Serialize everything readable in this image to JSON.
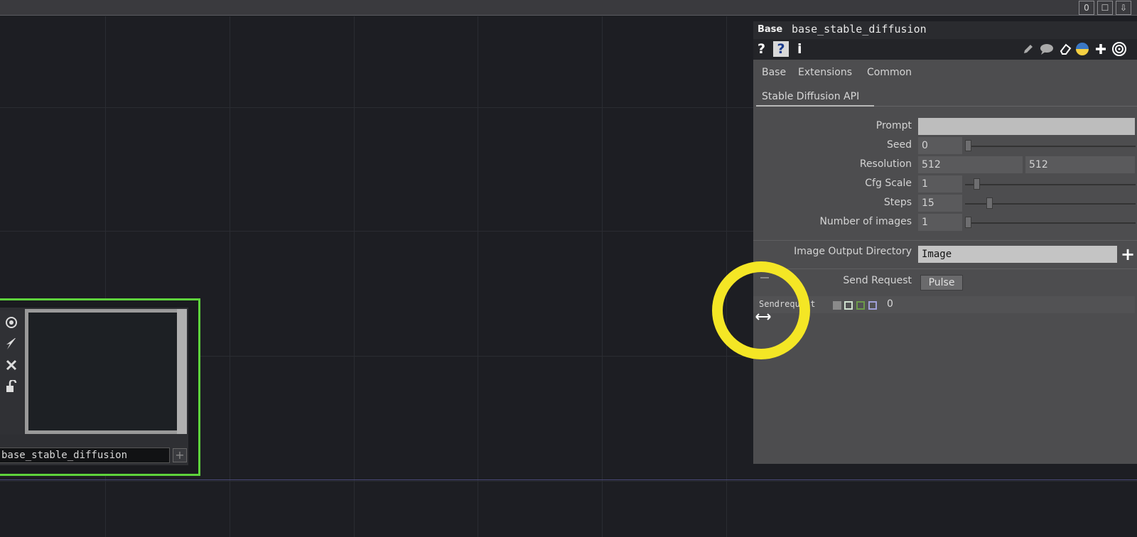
{
  "topbar": {
    "buttons": [
      {
        "name": "counter-button",
        "label": "0"
      },
      {
        "name": "maximize-icon",
        "label": "☐"
      },
      {
        "name": "download-icon",
        "label": "⇩"
      }
    ]
  },
  "node": {
    "label": "base_stable_diffusion",
    "plus": "+",
    "icons": [
      "target-icon",
      "lightning-icon",
      "close-icon",
      "lock-icon"
    ]
  },
  "panel": {
    "op_type": "Base",
    "op_name": "base_stable_diffusion",
    "help": "?",
    "help_py": "?",
    "info": "i",
    "tabs": [
      "Base",
      "Extensions",
      "Common"
    ],
    "page": "Stable Diffusion API",
    "params": {
      "prompt": {
        "label": "Prompt",
        "value": ""
      },
      "seed": {
        "label": "Seed",
        "value": "0",
        "slider": 0.0
      },
      "resolution": {
        "label": "Resolution",
        "value1": "512",
        "value2": "512"
      },
      "cfg_scale": {
        "label": "Cfg Scale",
        "value": "1",
        "slider": 0.05
      },
      "steps": {
        "label": "Steps",
        "value": "15",
        "slider": 0.14
      },
      "num_images": {
        "label": "Number of images",
        "value": "1",
        "slider": 0.0
      },
      "output_dir": {
        "label": "Image Output Directory",
        "value": "Image",
        "add": "+"
      },
      "send_request": {
        "label": "Send Request",
        "button": "Pulse"
      }
    },
    "sendrequest_row": {
      "label": "Sendrequest",
      "value": "0"
    }
  },
  "colors": {
    "node_border": "#5ed33c",
    "highlight": "#f4e625",
    "panel_bg": "#4d4d4f"
  }
}
